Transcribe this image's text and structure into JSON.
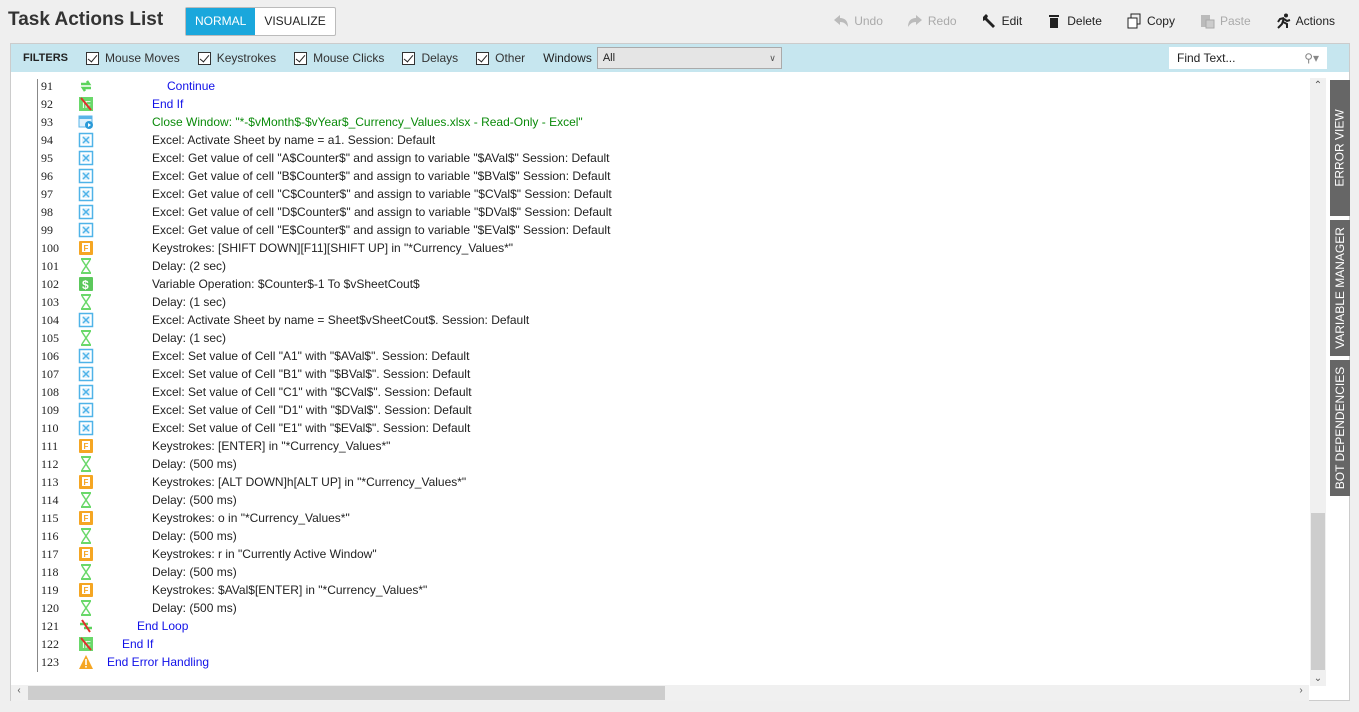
{
  "header": {
    "title": "Task Actions List",
    "modes": [
      "NORMAL",
      "VISUALIZE"
    ],
    "active_mode": "NORMAL"
  },
  "toolbar": {
    "undo": "Undo",
    "redo": "Redo",
    "edit": "Edit",
    "delete": "Delete",
    "copy": "Copy",
    "paste": "Paste",
    "actions": "Actions"
  },
  "filters": {
    "label": "FILTERS",
    "items": [
      "Mouse Moves",
      "Keystrokes",
      "Mouse Clicks",
      "Delays",
      "Other"
    ],
    "windows_label": "Windows",
    "windows_value": "All",
    "find_placeholder": "Find Text..."
  },
  "side_tabs": [
    "ERROR VIEW",
    "VARIABLE MANAGER",
    "BOT DEPENDENCIES"
  ],
  "rows": [
    {
      "n": "91",
      "icon": "continue",
      "level": 4,
      "color": "blue",
      "text": "Continue"
    },
    {
      "n": "92",
      "icon": "end-if",
      "level": 3,
      "color": "blue",
      "text": "End If"
    },
    {
      "n": "93",
      "icon": "window",
      "level": 3,
      "color": "green",
      "text": "Close Window: \"*-$vMonth$-$vYear$_Currency_Values.xlsx  -  Read-Only - Excel\""
    },
    {
      "n": "94",
      "icon": "excel",
      "level": 3,
      "color": "black",
      "text": "Excel: Activate Sheet by name = a1. Session: Default"
    },
    {
      "n": "95",
      "icon": "excel",
      "level": 3,
      "color": "black",
      "text": "Excel: Get value of cell \"A$Counter$\" and assign to variable \"$AVal$\" Session: Default"
    },
    {
      "n": "96",
      "icon": "excel",
      "level": 3,
      "color": "black",
      "text": "Excel: Get value of cell \"B$Counter$\" and assign to variable \"$BVal$\" Session: Default"
    },
    {
      "n": "97",
      "icon": "excel",
      "level": 3,
      "color": "black",
      "text": "Excel: Get value of cell \"C$Counter$\" and assign to variable \"$CVal$\" Session: Default"
    },
    {
      "n": "98",
      "icon": "excel",
      "level": 3,
      "color": "black",
      "text": "Excel: Get value of cell \"D$Counter$\" and assign to variable \"$DVal$\" Session: Default"
    },
    {
      "n": "99",
      "icon": "excel",
      "level": 3,
      "color": "black",
      "text": "Excel: Get value of cell \"E$Counter$\" and assign to variable \"$EVal$\" Session: Default"
    },
    {
      "n": "100",
      "icon": "keystroke",
      "level": 3,
      "color": "black",
      "text": "Keystrokes: [SHIFT DOWN][F11][SHIFT UP] in \"*Currency_Values*\""
    },
    {
      "n": "101",
      "icon": "delay",
      "level": 3,
      "color": "black",
      "text": "Delay: (2 sec)"
    },
    {
      "n": "102",
      "icon": "variable",
      "level": 3,
      "color": "black",
      "text": "Variable Operation: $Counter$-1 To $vSheetCout$"
    },
    {
      "n": "103",
      "icon": "delay",
      "level": 3,
      "color": "black",
      "text": "Delay: (1 sec)"
    },
    {
      "n": "104",
      "icon": "excel",
      "level": 3,
      "color": "black",
      "text": "Excel: Activate Sheet by name = Sheet$vSheetCout$. Session: Default"
    },
    {
      "n": "105",
      "icon": "delay",
      "level": 3,
      "color": "black",
      "text": "Delay: (1 sec)"
    },
    {
      "n": "106",
      "icon": "excel",
      "level": 3,
      "color": "black",
      "text": "Excel: Set value of Cell \"A1\" with \"$AVal$\". Session: Default"
    },
    {
      "n": "107",
      "icon": "excel",
      "level": 3,
      "color": "black",
      "text": "Excel: Set value of Cell \"B1\" with \"$BVal$\". Session: Default"
    },
    {
      "n": "108",
      "icon": "excel",
      "level": 3,
      "color": "black",
      "text": "Excel: Set value of Cell \"C1\" with \"$CVal$\". Session: Default"
    },
    {
      "n": "109",
      "icon": "excel",
      "level": 3,
      "color": "black",
      "text": "Excel: Set value of Cell \"D1\" with \"$DVal$\". Session: Default"
    },
    {
      "n": "110",
      "icon": "excel",
      "level": 3,
      "color": "black",
      "text": "Excel: Set value of Cell \"E1\" with \"$EVal$\". Session: Default"
    },
    {
      "n": "111",
      "icon": "keystroke",
      "level": 3,
      "color": "black",
      "text": "Keystrokes: [ENTER] in \"*Currency_Values*\""
    },
    {
      "n": "112",
      "icon": "delay",
      "level": 3,
      "color": "black",
      "text": "Delay: (500 ms)"
    },
    {
      "n": "113",
      "icon": "keystroke",
      "level": 3,
      "color": "black",
      "text": "Keystrokes: [ALT DOWN]h[ALT UP] in \"*Currency_Values*\""
    },
    {
      "n": "114",
      "icon": "delay",
      "level": 3,
      "color": "black",
      "text": "Delay: (500 ms)"
    },
    {
      "n": "115",
      "icon": "keystroke",
      "level": 3,
      "color": "black",
      "text": "Keystrokes: o in \"*Currency_Values*\""
    },
    {
      "n": "116",
      "icon": "delay",
      "level": 3,
      "color": "black",
      "text": "Delay: (500 ms)"
    },
    {
      "n": "117",
      "icon": "keystroke",
      "level": 3,
      "color": "black",
      "text": "Keystrokes: r in \"Currently Active Window\""
    },
    {
      "n": "118",
      "icon": "delay",
      "level": 3,
      "color": "black",
      "text": "Delay: (500 ms)"
    },
    {
      "n": "119",
      "icon": "keystroke",
      "level": 3,
      "color": "black",
      "text": "Keystrokes: $AVal$[ENTER] in \"*Currency_Values*\""
    },
    {
      "n": "120",
      "icon": "delay",
      "level": 3,
      "color": "black",
      "text": "Delay: (500 ms)"
    },
    {
      "n": "121",
      "icon": "end-loop",
      "level": 2,
      "color": "blue",
      "text": "End Loop"
    },
    {
      "n": "122",
      "icon": "end-if",
      "level": 1,
      "color": "blue",
      "text": "End If"
    },
    {
      "n": "123",
      "icon": "error",
      "level": 0,
      "color": "blue",
      "text": "End Error Handling"
    }
  ]
}
